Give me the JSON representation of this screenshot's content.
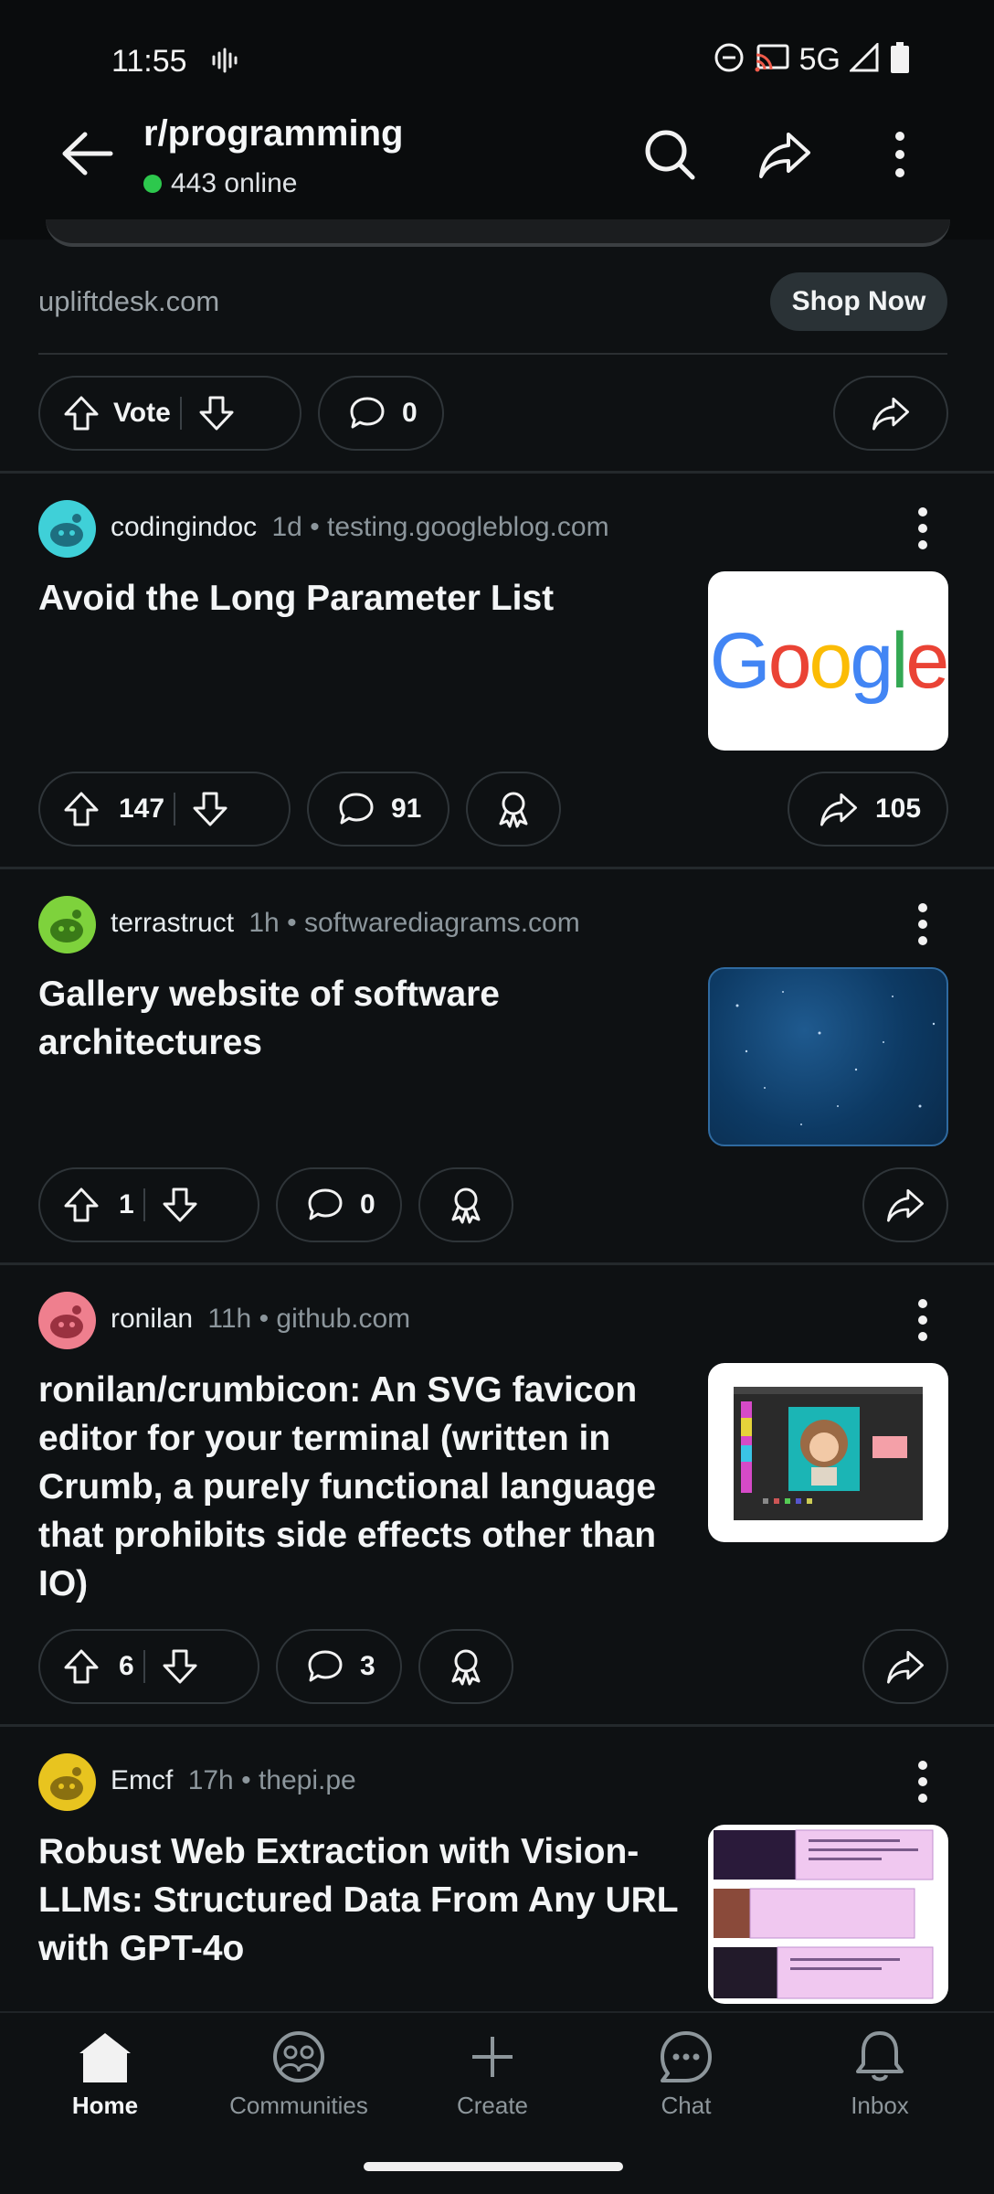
{
  "status_bar": {
    "time": "11:55",
    "network": "5G"
  },
  "header": {
    "title": "r/programming",
    "online": "443 online"
  },
  "ad": {
    "domain": "upliftdesk.com",
    "cta": "Shop Now",
    "vote_label": "Vote",
    "comments": "0"
  },
  "posts": [
    {
      "author": "codingindoc",
      "age": "1d",
      "domain": "testing.googleblog.com",
      "title": "Avoid the Long Parameter List",
      "votes": "147",
      "comments": "91",
      "shares": "105",
      "avatar_color": "#3fd0d8",
      "thumb_text": "Google"
    },
    {
      "author": "terrastruct",
      "age": "1h",
      "domain": "softwarediagrams.com",
      "title": "Gallery website of software architectures",
      "votes": "1",
      "comments": "0",
      "avatar_color": "#7ed23c"
    },
    {
      "author": "ronilan",
      "age": "11h",
      "domain": "github.com",
      "title": "ronilan/crumbicon: An SVG favicon editor for your terminal (written in Crumb, a purely functional language that prohibits side effects other than IO)",
      "votes": "6",
      "comments": "3",
      "avatar_color": "#ef7f8e"
    },
    {
      "author": "Emcf",
      "age": "17h",
      "domain": "thepi.pe",
      "title": "Robust Web Extraction with Vision-LLMs: Structured Data From Any URL with GPT-4o",
      "avatar_color": "#e8c41f"
    }
  ],
  "nav": {
    "home": "Home",
    "communities": "Communities",
    "create": "Create",
    "chat": "Chat",
    "inbox": "Inbox"
  },
  "colors": {
    "background": "#0e1113",
    "online_dot": "#2dc84d",
    "pill_border": "#2f3539"
  }
}
